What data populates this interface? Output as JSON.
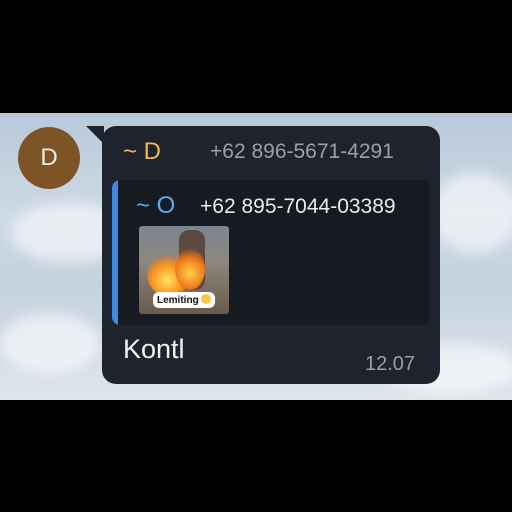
{
  "chat": {
    "avatar_letter": "D",
    "sender_name": "~ D",
    "sender_phone": "+62 896-5671-4291",
    "reply": {
      "sender_name": "~ O",
      "sender_phone": "+62 895-7044-03389",
      "thumbnail_caption": "Lemiting"
    },
    "message_text": "Kontl",
    "timestamp": "12.07"
  },
  "colors": {
    "bubble": "#1e232d",
    "sender_name": "#f2b84b",
    "reply_accent": "#3d8be0",
    "avatar": "#7d5426"
  }
}
